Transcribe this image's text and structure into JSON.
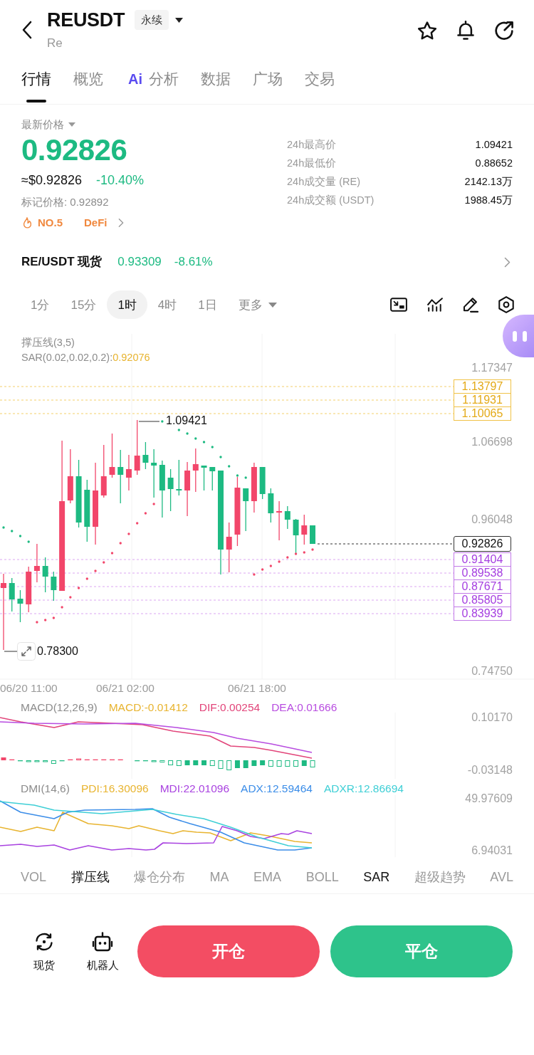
{
  "header": {
    "title": "REUSDT",
    "badge": "永续",
    "subtitle": "Re"
  },
  "tabs": [
    {
      "label": "行情",
      "selected": true
    },
    {
      "label": "概览",
      "selected": false
    },
    {
      "label": "分析",
      "badge": "Ai",
      "selected": false
    },
    {
      "label": "数据",
      "selected": false
    },
    {
      "label": "广场",
      "selected": false
    },
    {
      "label": "交易",
      "selected": false
    }
  ],
  "ticker": {
    "label": "最新价格",
    "price": "0.92826",
    "negative": true,
    "usd_price": "≈$0.92826",
    "change": "-10.40%",
    "mark_price": "标记价格: 0.92892",
    "rank": "NO.5",
    "sector": "DeFi"
  },
  "stats": [
    {
      "label": "24h最高价",
      "value": "1.09421"
    },
    {
      "label": "24h最低价",
      "value": "0.88652"
    },
    {
      "label": "24h成交量 (RE)",
      "value": "2142.13万"
    },
    {
      "label": "24h成交额 (USDT)",
      "value": "1988.45万"
    }
  ],
  "spot": {
    "pair": "RE/USDT 现货",
    "price": "0.93309",
    "change": "-8.61%",
    "negative": true
  },
  "intervals": [
    {
      "label": "1分",
      "selected": false,
      "kind": "interval"
    },
    {
      "label": "15分",
      "selected": false,
      "kind": "interval"
    },
    {
      "label": "1时",
      "selected": true,
      "kind": "interval"
    },
    {
      "label": "4时",
      "selected": false,
      "kind": "interval"
    },
    {
      "label": "1日",
      "selected": false,
      "kind": "interval"
    },
    {
      "label": "更多",
      "selected": false,
      "kind": "menu"
    }
  ],
  "chart": {
    "indicator": "撑压线(3,5)",
    "sar": {
      "label": "SAR(0.02,0.02,0.2):",
      "value": "0.92076"
    },
    "price_axis": [
      "1.17347",
      "1.06698",
      "0.96048",
      "0.74750"
    ],
    "resistance_levels": [
      "1.13797",
      "1.11931",
      "1.10065"
    ],
    "current_price": "0.92826",
    "support_levels": [
      "0.91404",
      "0.89538",
      "0.87671",
      "0.85805",
      "0.83939"
    ],
    "high_marker": "1.09421",
    "low_marker": "0.78300",
    "time_axis": [
      "06/20 11:00",
      "06/21 02:00",
      "06/21 18:00"
    ]
  },
  "macd": {
    "name": "MACD(12,26,9)",
    "values": [
      {
        "label": "MACD:-0.01412",
        "color": "#e8b430"
      },
      {
        "label": "DIF:0.00254",
        "color": "#e2457a"
      },
      {
        "label": "DEA:0.01666",
        "color": "#b84de0"
      }
    ],
    "axis": [
      "0.10170",
      "-0.03148"
    ]
  },
  "dmi": {
    "name": "DMI(14,6)",
    "values": [
      {
        "label": "PDI:16.30096",
        "color": "#e8b430"
      },
      {
        "label": "MDI:22.01096",
        "color": "#a943e0"
      },
      {
        "label": "ADX:12.59464",
        "color": "#3b8de8"
      },
      {
        "label": "ADXR:12.86694",
        "color": "#3fcfd6"
      }
    ],
    "axis": [
      "49.97609",
      "6.94031"
    ]
  },
  "indicator_tabs": [
    {
      "label": "VOL",
      "selected": false
    },
    {
      "label": "撑压线",
      "selected": true
    },
    {
      "label": "爆仓分布",
      "selected": false
    },
    {
      "label": "MA",
      "selected": false
    },
    {
      "label": "EMA",
      "selected": false
    },
    {
      "label": "BOLL",
      "selected": false
    },
    {
      "label": "SAR",
      "selected": true
    },
    {
      "label": "超级趋势",
      "selected": false
    },
    {
      "label": "AVL",
      "selected": false
    }
  ],
  "bottom_bar": {
    "shortcuts": [
      {
        "label": "现货",
        "kind": "spot"
      },
      {
        "label": "机器人",
        "kind": "robot"
      }
    ],
    "actions": [
      {
        "label": "开仓",
        "kind": "open"
      },
      {
        "label": "平仓",
        "kind": "close"
      }
    ]
  }
}
